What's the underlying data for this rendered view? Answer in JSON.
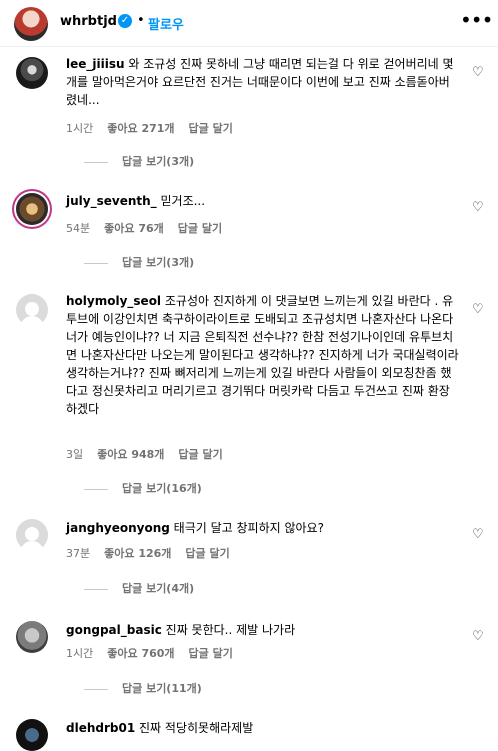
{
  "header": {
    "username": "whrbtjd",
    "separator": "•",
    "follow_label": "팔로우",
    "more_icon": "•••"
  },
  "comments": [
    {
      "user": "lee_jiiisu",
      "text": "와 조규성 진짜 못하네 그냥 때리면 되는걸 다 위로 걷어버리네 몇개를 말아먹은거야 요르단전 진거는 너때문이다 이번에 보고 진짜 소름돋아버렸네...",
      "time": "1시간",
      "likes": "좋아요 271개",
      "reply": "답글 달기",
      "replies": "답글 보기(3개)"
    },
    {
      "user": "july_seventh_",
      "text": "믿거조...",
      "time": "54분",
      "likes": "좋아요 76개",
      "reply": "답글 달기",
      "replies": "답글 보기(3개)"
    },
    {
      "user": "holymoly_seol",
      "text": "조규성아 진지하게 이 댓글보면 느끼는게 있길 바란다 . 유투브에 이강인치면 축구하이라이트로 도배되고 조규성치면 나혼자산다 나온다 너가 예능인이냐?? 너 지금 은퇴직전 선수냐?? 한참 전성기나이인데 유투브치면 나혼자산다만 나오는게 말이된다고 생각하냐?? 진지하게 너가 국대실력이라 생각하는거냐?? 진짜 뼈저리게 느끼는게 있길 바란다 사람들이 외모칭찬좀 했다고 정신못차리고 머리기르고 경기뛰다 머릿카락 다듬고 두건쓰고 진짜 환장하겠다",
      "time": "3일",
      "likes": "좋아요 948개",
      "reply": "답글 달기",
      "replies": "답글 보기(16개)"
    },
    {
      "user": "janghyeonyong",
      "text": "태극기 달고 창피하지 않아요?",
      "time": "37분",
      "likes": "좋아요 126개",
      "reply": "답글 달기",
      "replies": "답글 보기(4개)"
    },
    {
      "user": "gongpal_basic",
      "text": "진짜 못한다.. 제발 나가라",
      "time": "1시간",
      "likes": "좋아요 760개",
      "reply": "답글 달기",
      "replies": "답글 보기(11개)"
    },
    {
      "user": "dlehdrb01",
      "text": "진짜 적당히못해라제발",
      "time": "",
      "likes": "",
      "reply": "",
      "replies": ""
    }
  ],
  "icons": {
    "heart": "♡",
    "verified": "✓"
  }
}
